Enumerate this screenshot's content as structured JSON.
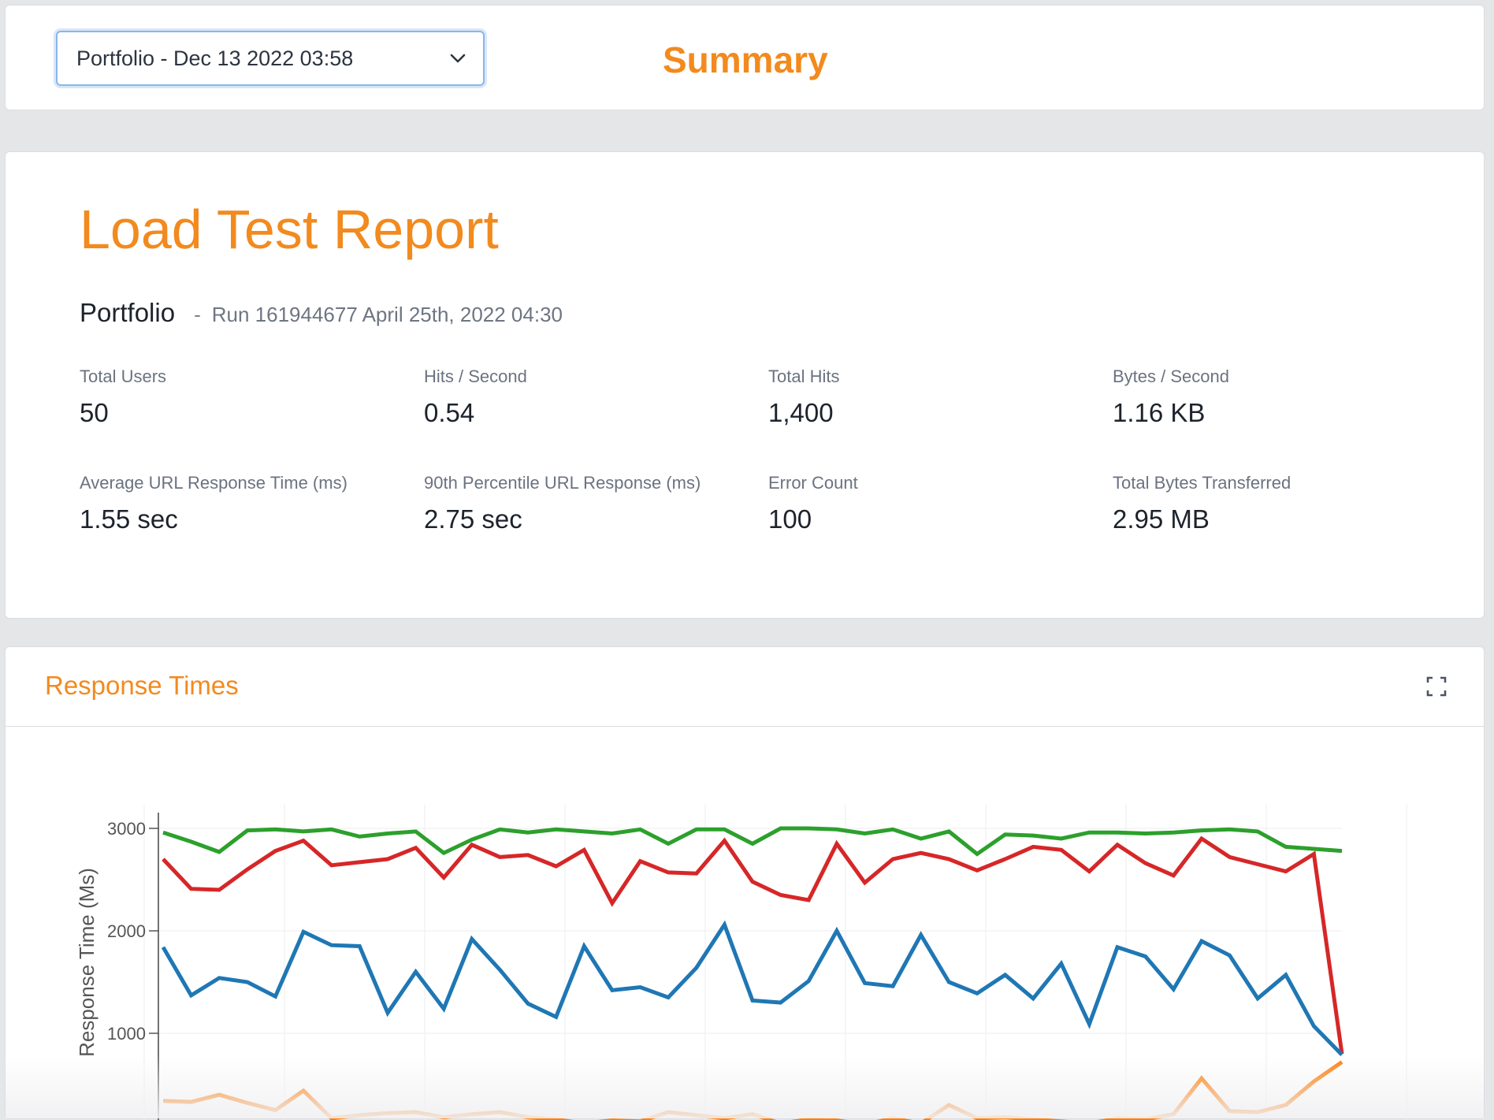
{
  "header": {
    "run_selector": {
      "value": "Portfolio - Dec 13 2022 03:58"
    },
    "summary_title": "Summary"
  },
  "report": {
    "title": "Load Test Report",
    "project": "Portfolio",
    "separator": "-",
    "run_info": "Run 161944677 April 25th, 2022 04:30",
    "stats": [
      {
        "label": "Total Users",
        "value": "50"
      },
      {
        "label": "Hits / Second",
        "value": "0.54"
      },
      {
        "label": "Total Hits",
        "value": "1,400"
      },
      {
        "label": "Bytes / Second",
        "value": "1.16 KB"
      },
      {
        "label": "Average URL Response Time (ms)",
        "value": "1.55 sec"
      },
      {
        "label": "90th Percentile URL Response (ms)",
        "value": "2.75 sec"
      },
      {
        "label": "Error Count",
        "value": "100"
      },
      {
        "label": "Total Bytes Transferred",
        "value": "2.95 MB"
      }
    ]
  },
  "chart_panel": {
    "title": "Response Times",
    "expand_icon": "expand-icon"
  },
  "chart_data": {
    "type": "line",
    "ylabel": "Response Time (Ms)",
    "ylim": [
      700,
      3000
    ],
    "yticks": [
      "1000",
      "2000",
      "3000"
    ],
    "grid": true,
    "legend": "none",
    "x": [
      0,
      1,
      2,
      3,
      4,
      5,
      6,
      7,
      8,
      9,
      10,
      11,
      12,
      13,
      14,
      15,
      16,
      17,
      18,
      19,
      20,
      21,
      22,
      23,
      24,
      25,
      26,
      27,
      28,
      29,
      30,
      31,
      32,
      33,
      34,
      35,
      36,
      37,
      38,
      39,
      40,
      41,
      42
    ],
    "series": [
      {
        "color": "#2ca02c",
        "values": [
          2960,
          2870,
          2770,
          2980,
          2990,
          2970,
          2990,
          2920,
          2950,
          2970,
          2760,
          2890,
          2990,
          2960,
          2990,
          2970,
          2950,
          2990,
          2850,
          2990,
          2990,
          2850,
          3000,
          3000,
          2990,
          2950,
          2990,
          2900,
          2970,
          2750,
          2940,
          2930,
          2900,
          2960,
          2960,
          2950,
          2960,
          2980,
          2990,
          2970,
          2820,
          2800,
          2780
        ]
      },
      {
        "color": "#d62728",
        "values": [
          2700,
          2410,
          2400,
          2600,
          2780,
          2880,
          2640,
          2670,
          2700,
          2810,
          2520,
          2840,
          2720,
          2740,
          2630,
          2790,
          2270,
          2680,
          2570,
          2560,
          2880,
          2480,
          2350,
          2300,
          2850,
          2470,
          2700,
          2760,
          2700,
          2590,
          2700,
          2820,
          2790,
          2580,
          2840,
          2660,
          2540,
          2900,
          2720,
          2650,
          2580,
          2750,
          800
        ]
      },
      {
        "color": "#1f77b4",
        "values": [
          1840,
          1370,
          1540,
          1500,
          1360,
          1990,
          1860,
          1850,
          1200,
          1600,
          1240,
          1920,
          1620,
          1290,
          1160,
          1850,
          1420,
          1450,
          1350,
          1640,
          2060,
          1320,
          1300,
          1510,
          2000,
          1490,
          1460,
          1960,
          1500,
          1390,
          1570,
          1340,
          1680,
          1090,
          1840,
          1750,
          1430,
          1900,
          1760,
          1340,
          1570,
          1070,
          790
        ]
      },
      {
        "color": "#ff7f0e",
        "values": [
          340,
          330,
          400,
          320,
          250,
          440,
          170,
          200,
          220,
          230,
          180,
          210,
          230,
          180,
          160,
          120,
          150,
          140,
          230,
          200,
          170,
          210,
          120,
          160,
          150,
          110,
          170,
          120,
          300,
          170,
          180,
          160,
          140,
          120,
          170,
          160,
          210,
          560,
          240,
          230,
          300,
          530,
          720
        ]
      }
    ]
  }
}
